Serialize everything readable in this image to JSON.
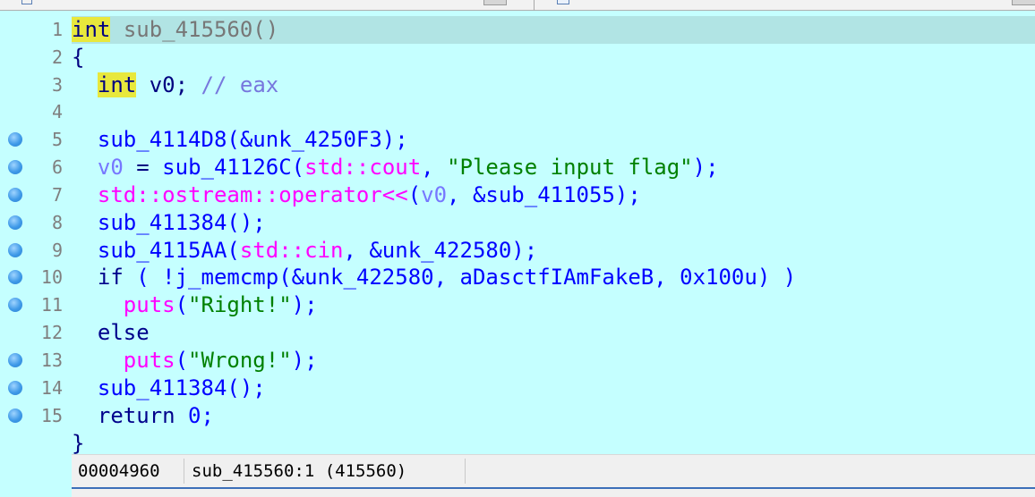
{
  "gutter": {
    "line_numbers": [
      "1",
      "2",
      "3",
      "4",
      "5",
      "6",
      "7",
      "8",
      "9",
      "10",
      "11",
      "12",
      "13",
      "14",
      "15"
    ],
    "breakpoints_on_lines": [
      5,
      6,
      7,
      8,
      9,
      10,
      11,
      13,
      14,
      15
    ],
    "breakpoint_color": "#3f9ae8"
  },
  "code": {
    "l1": {
      "type": "int",
      "func": "sub_415560()"
    },
    "l2": {
      "brace": "{"
    },
    "l3": {
      "type": "int",
      "decl": "v0;",
      "comment": "// eax"
    },
    "l5": {
      "call": "sub_4114D8(&unk_4250F3);"
    },
    "l6": {
      "lhs": "v0",
      "eq": " = ",
      "call": "sub_41126C(",
      "ns": "std::cout",
      "comma": ", ",
      "str": "\"Please input flag\"",
      "close": ");"
    },
    "l7": {
      "op": "std::ostream::operator<<",
      "open": "(",
      "arg1": "v0",
      "rest": ", &sub_411055);"
    },
    "l8": {
      "call": "sub_411384();"
    },
    "l9": {
      "call": "sub_4115AA(",
      "ns": "std::cin",
      "rest": ", &unk_422580);"
    },
    "l10": {
      "kw": "if",
      "rest": " ( !j_memcmp(&unk_422580, aDasctfIAmFakeB, 0x100u) )"
    },
    "l11": {
      "fn": "puts",
      "open": "(",
      "str": "\"Right!\"",
      "close": ");"
    },
    "l12": {
      "kw": "else"
    },
    "l13": {
      "fn": "puts",
      "open": "(",
      "str": "\"Wrong!\"",
      "close": ");"
    },
    "l14": {
      "call": "sub_411384();"
    },
    "l15": {
      "kw": "return",
      "rest": " 0;"
    },
    "l16": {
      "brace": "}"
    }
  },
  "status": {
    "offset": "00004960",
    "location": "sub_415560:1 (415560)"
  },
  "colors": {
    "background": "#c5ffff",
    "current_line": "#b1e4e4",
    "highlight": "#e8e83c",
    "string": "#008000",
    "identifier": "#0000ff",
    "library": "#ff00ff"
  }
}
